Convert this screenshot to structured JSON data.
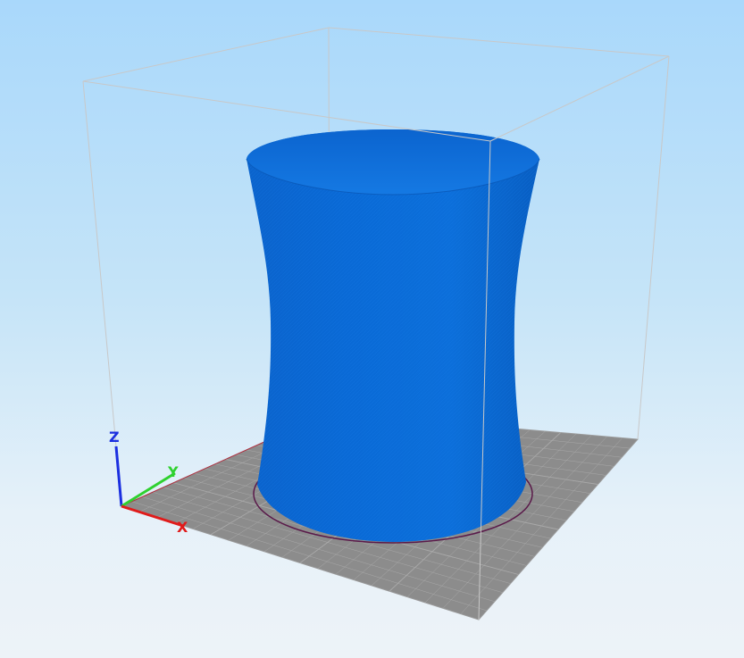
{
  "viewer": {
    "axes": {
      "x_label": "X",
      "y_label": "Y",
      "z_label": "Z",
      "x_color": "#e01b1b",
      "y_color": "#2fd12f",
      "z_color": "#1b2fe0"
    },
    "colors": {
      "model": "#0a6ad6",
      "model_dark": "#0752b0",
      "model_light": "#1c82ee",
      "bed": "#8c8c8c",
      "bed_grid": "#a9a9a9",
      "bed_outline_circle": "#5a1a4a",
      "bounding_box": "#c8c8c8",
      "background_top": "#a9d8fb",
      "background_bottom": "#edf3f8"
    },
    "model": {
      "shape": "hyperboloid vase",
      "icon": "vase-model-icon"
    }
  }
}
